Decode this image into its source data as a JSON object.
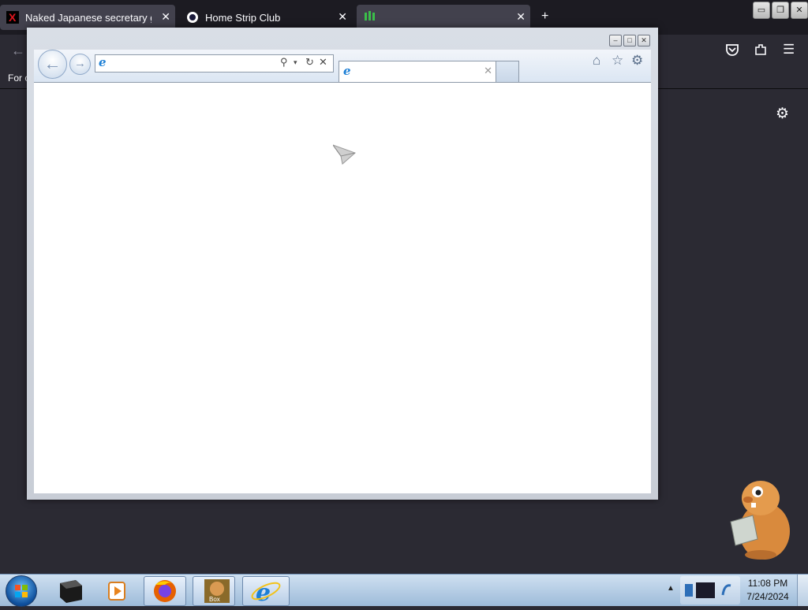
{
  "firefox": {
    "tabs": [
      {
        "label": "Naked Japanese secretary get u",
        "icon": "x-red-icon"
      },
      {
        "label": "Home Strip Club",
        "icon": "circle-favicon-icon"
      },
      {
        "label": "",
        "icon": "green-figure-icon"
      }
    ],
    "bookmarks_text": "For c",
    "win_controls": {
      "minimize": "▭",
      "restore": "❐",
      "close": "✕"
    }
  },
  "ie": {
    "address": {
      "value": "",
      "placeholder": ""
    },
    "tab": {
      "label": ""
    },
    "caption": {
      "minimize": "–",
      "maximize": "□",
      "close": "✕"
    }
  },
  "taskbar": {
    "clock": {
      "time": "11:08 PM",
      "date": "7/24/2024"
    },
    "items": [
      "black-cube-icon",
      "media-player-icon",
      "firefox-icon",
      "bonzi-box-icon",
      "internet-explorer-icon"
    ]
  },
  "colors": {
    "firefox_bg": "#2b2a33",
    "taskbar": "#a9c4e0",
    "ie_blue": "#1c7fd6"
  }
}
